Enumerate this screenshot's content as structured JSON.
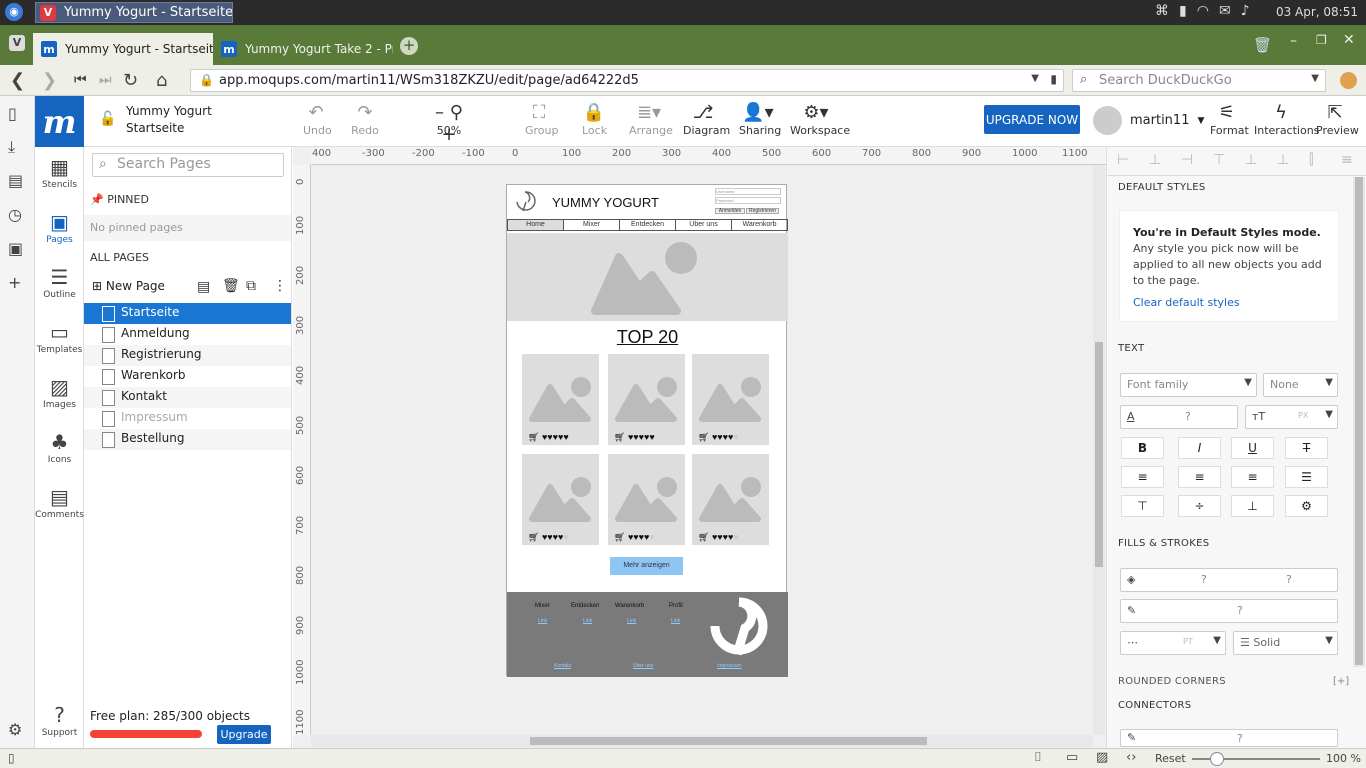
{
  "os": {
    "task_title": "Yummy Yogurt - Startseite · ...",
    "clock": "03 Apr, 08:51"
  },
  "browser": {
    "tabs": [
      {
        "label": "Yummy Yogurt - Startseite ·"
      },
      {
        "label": "Yummy Yogurt Take 2 - Prod"
      }
    ],
    "url": "app.moqups.com/martin11/WSm318ZKZU/edit/page/ad64222d5",
    "search_placeholder": "Search DuckDuckGo"
  },
  "app": {
    "logo": "m",
    "project_name": "Yummy Yogurt",
    "page_name": "Startseite",
    "tools": [
      {
        "label": "Undo",
        "icon": "undo-icon"
      },
      {
        "label": "Redo",
        "icon": "redo-icon"
      },
      {
        "label": "50%",
        "icon": "zoom-icon"
      },
      {
        "label": "Group",
        "icon": "group-icon"
      },
      {
        "label": "Lock",
        "icon": "lock-icon"
      },
      {
        "label": "Arrange",
        "icon": "arrange-icon"
      },
      {
        "label": "Diagram",
        "icon": "diagram-icon"
      },
      {
        "label": "Sharing",
        "icon": "sharing-icon"
      },
      {
        "label": "Workspace",
        "icon": "workspace-icon"
      }
    ],
    "upgrade_now": "UPGRADE NOW",
    "user": "martin11",
    "right_tools": [
      {
        "label": "Format"
      },
      {
        "label": "Interactions"
      },
      {
        "label": "Preview"
      }
    ]
  },
  "rail": [
    {
      "label": "Stencils"
    },
    {
      "label": "Pages"
    },
    {
      "label": "Outline"
    },
    {
      "label": "Templates"
    },
    {
      "label": "Images"
    },
    {
      "label": "Icons"
    },
    {
      "label": "Comments"
    },
    {
      "label": "Support"
    }
  ],
  "pages_panel": {
    "search_placeholder": "Search Pages",
    "pinned_title": "PINNED",
    "no_pinned": "No pinned pages",
    "all_pages_title": "ALL PAGES",
    "new_page": "New Page",
    "pages": [
      "Startseite",
      "Anmeldung",
      "Registrierung",
      "Warenkorb",
      "Kontakt",
      "Impressum",
      "Bestellung"
    ],
    "free_plan": "Free plan: 285/300 objects",
    "plan_used_fraction": 0.95,
    "upgrade": "Upgrade"
  },
  "rulers": {
    "h": [
      "400",
      "-300",
      "-200",
      "-100",
      "0",
      "100",
      "200",
      "300",
      "400",
      "500",
      "600",
      "700",
      "800",
      "900",
      "1000",
      "1100"
    ],
    "v": [
      "0",
      "100",
      "200",
      "300",
      "400",
      "500",
      "600",
      "700",
      "800",
      "900",
      "1000",
      "1100"
    ]
  },
  "mockup": {
    "brand": "YUMMY YOGURT",
    "login_user": "Username",
    "login_pass": "Password",
    "btn_login": "Anmelden",
    "btn_register": "Registrieren",
    "nav": [
      "Home",
      "Mixer",
      "Entdecken",
      "Über uns",
      "Warenkorb"
    ],
    "top_title": "TOP 20",
    "cards": [
      {
        "rating": 5
      },
      {
        "rating": 5
      },
      {
        "rating": 4
      },
      {
        "rating": 4
      },
      {
        "rating": 4
      },
      {
        "rating": 4
      }
    ],
    "more_button": "Mehr anzeigen",
    "footer_cols": [
      "Mixer",
      "Entdecken",
      "Warenkorb",
      "Profil"
    ],
    "footer_link": "Link",
    "footer_bottom": [
      "Kontakt",
      "Über uns",
      "Impressum"
    ]
  },
  "right_panel": {
    "default_styles_title": "DEFAULT STYLES",
    "ds_heading": "You're in Default Styles mode.",
    "ds_text": "Any style you pick now will be applied to all new objects you add to the page.",
    "ds_link": "Clear default styles",
    "text_title": "TEXT",
    "font_family_placeholder": "Font family",
    "font_none": "None",
    "q": "?",
    "px": "PX",
    "pt": "PT",
    "fills_title": "FILLS & STROKES",
    "stroke_style": "Solid",
    "rounded_title": "ROUNDED CORNERS",
    "rounded_add": "[+]",
    "connectors_title": "CONNECTORS"
  },
  "status": {
    "reset": "Reset",
    "zoom": "100 %"
  }
}
